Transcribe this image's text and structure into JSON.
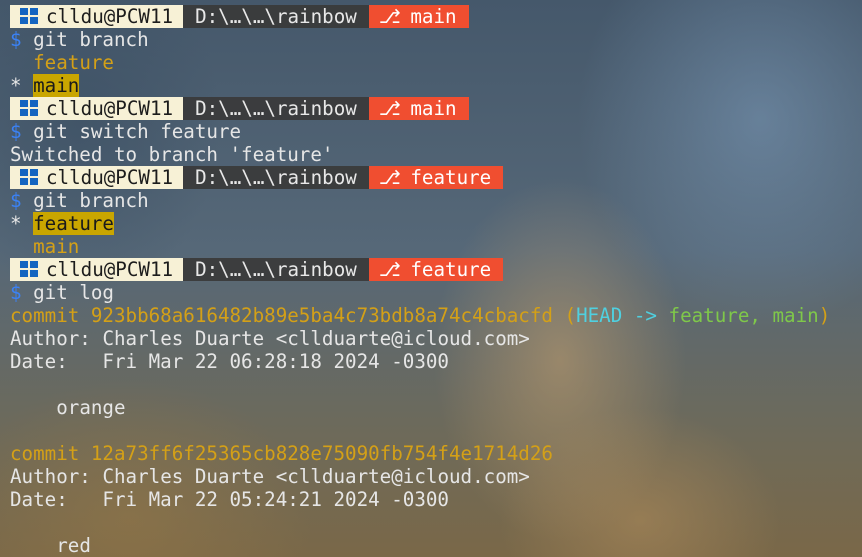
{
  "prompt": {
    "user": "clldu@PCW11",
    "path": "D:\\…\\…\\rainbow",
    "branch_icon": "git-branch-icon",
    "os_icon": "windows-logo-icon"
  },
  "colors": {
    "prompt_user_bg": "#f7f1d6",
    "prompt_path_bg": "#3a3a3a",
    "prompt_branch_bg": "#f04e30",
    "dollar": "#3b82f6",
    "yellow": "#d4a017",
    "current_branch_highlight": "#c9a600",
    "head_cyan": "#4fd0e0",
    "ref_green": "#7fc84a"
  },
  "lines": {
    "p1_branch": "main",
    "cmd1": "git branch",
    "branch_list_1": [
      "feature",
      "main"
    ],
    "current_marker": "*",
    "p2_branch": "main",
    "cmd2": "git switch feature",
    "switch_output": "Switched to branch 'feature'",
    "p3_branch": "feature",
    "cmd3": "git branch",
    "branch_list_2": [
      "feature",
      "main"
    ],
    "p4_branch": "feature",
    "cmd4": "git log",
    "prompt_symbol": "$"
  },
  "log": {
    "commit_label": "commit",
    "commits": [
      {
        "hash": "923bb68a616482b89e5ba4c73bdb8a74c4cbacfd",
        "refs_open": "(",
        "head": "HEAD ->",
        "refs": "feature, main",
        "refs_close": ")",
        "author_label": "Author:",
        "author": "Charles Duarte <cllduarte@icloud.com>",
        "date_label": "Date:",
        "date": "Fri Mar 22 06:28:18 2024 -0300",
        "message": "orange"
      },
      {
        "hash": "12a73ff6f25365cb828e75090fb754f4e1714d26",
        "author_label": "Author:",
        "author": "Charles Duarte <cllduarte@icloud.com>",
        "date_label": "Date:",
        "date": "Fri Mar 22 05:24:21 2024 -0300",
        "message": "red"
      }
    ]
  }
}
